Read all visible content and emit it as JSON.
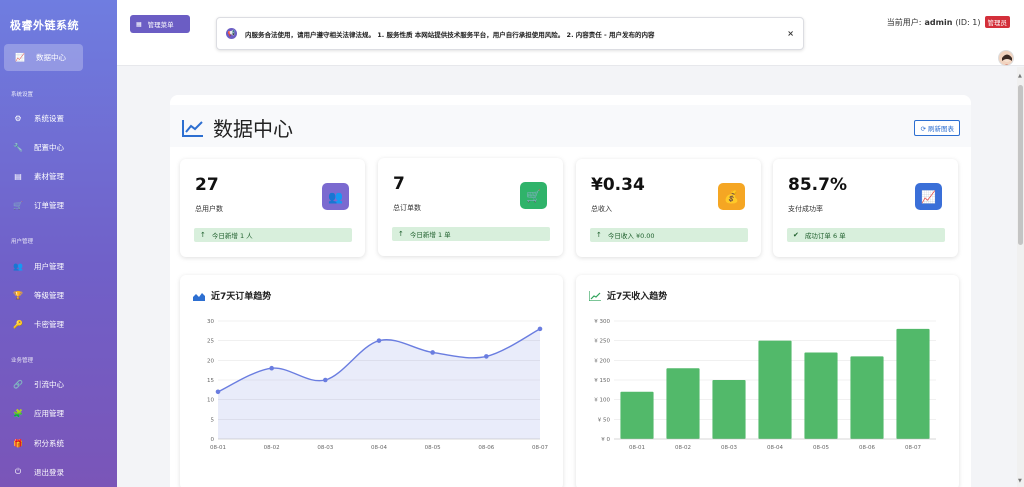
{
  "sidebar": {
    "brand": "极睿外链系统",
    "active_item": "数据中心",
    "sections": [
      {
        "title": "系统设置",
        "items": [
          "系统设置",
          "配置中心",
          "素材管理",
          "订单管理"
        ]
      },
      {
        "title": "用户管理",
        "items": [
          "用户管理",
          "等级管理",
          "卡密管理"
        ]
      },
      {
        "title": "业务管理",
        "items": [
          "引流中心",
          "应用管理",
          "积分系统",
          "退出登录"
        ]
      }
    ]
  },
  "topbar": {
    "menu_button": "管理菜单",
    "notice_text": "内服务合法使用，请用户遵守相关法律法规。 1. 服务性质 本网站提供技术服务平台，用户自行承担使用风险。 2. 内容责任 - 用户发布的内容",
    "notice_close": "×",
    "user_prefix": "当前用户:",
    "username": "admin",
    "user_id": "(ID: 1)",
    "role_badge": "管理员"
  },
  "page": {
    "title": "数据中心",
    "refresh_button": "刷新图表"
  },
  "stats": [
    {
      "value": "27",
      "label": "总用户数",
      "footer": "今日新增 1 人",
      "icon": "users-icon",
      "color": "#7b6ad0"
    },
    {
      "value": "7",
      "label": "总订单数",
      "footer": "今日新增 1 单",
      "icon": "cart-icon",
      "color": "#2fb36a"
    },
    {
      "value": "¥0.34",
      "label": "总收入",
      "footer": "今日收入 ¥0.00",
      "icon": "money-bag-icon",
      "color": "#f5a623"
    },
    {
      "value": "85.7%",
      "label": "支付成功率",
      "footer": "成功订单 6 单",
      "icon": "chart-icon",
      "color": "#3a6fd8"
    }
  ],
  "chart_titles": {
    "orders": "近7天订单趋势",
    "revenue": "近7天收入趋势"
  },
  "chart_data": [
    {
      "type": "area",
      "title": "近7天订单趋势",
      "categories": [
        "08-01",
        "08-02",
        "08-03",
        "08-04",
        "08-05",
        "08-06",
        "08-07"
      ],
      "values": [
        12,
        18,
        15,
        25,
        22,
        21,
        28
      ],
      "ylim": [
        0,
        30
      ],
      "yticks": [
        "0",
        "5",
        "10",
        "15",
        "20",
        "25",
        "30"
      ],
      "grid": true,
      "color": "#6a7de0"
    },
    {
      "type": "bar",
      "title": "近7天收入趋势",
      "categories": [
        "08-01",
        "08-02",
        "08-03",
        "08-04",
        "08-05",
        "08-06",
        "08-07"
      ],
      "values": [
        120,
        180,
        150,
        250,
        220,
        210,
        280
      ],
      "ylim": [
        0,
        300
      ],
      "yticks": [
        "¥ 0",
        "¥ 50",
        "¥ 100",
        "¥ 150",
        "¥ 200",
        "¥ 250",
        "¥ 300"
      ],
      "grid": true,
      "color": "#52b96a"
    }
  ]
}
